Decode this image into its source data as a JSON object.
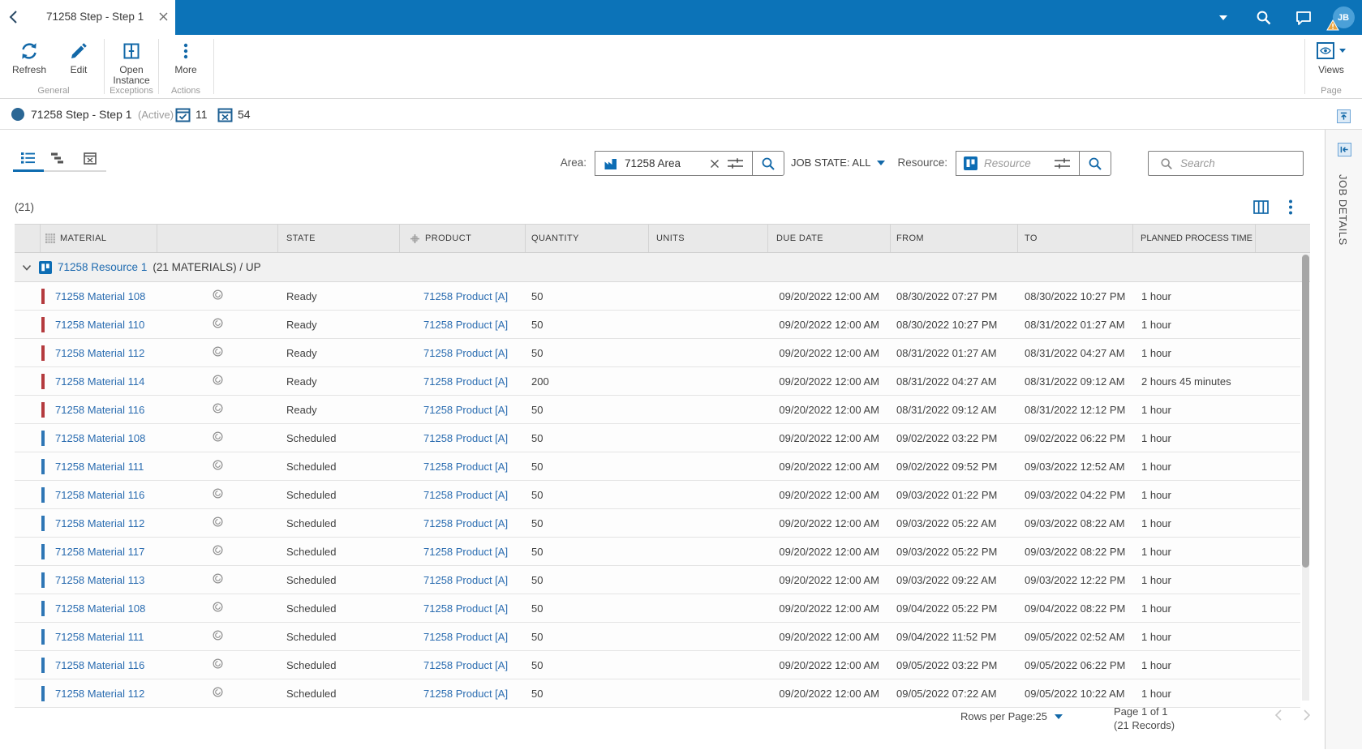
{
  "topbar": {
    "tab_title": "71258 Step - Step 1",
    "avatar_initials": "JB"
  },
  "ribbon": {
    "refresh_label": "Refresh",
    "edit_label": "Edit",
    "open_instance_label1": "Open",
    "open_instance_label2": "Instance",
    "more_label": "More",
    "views_label": "Views",
    "group_general": "General",
    "group_exceptions": "Exceptions",
    "group_actions": "Actions",
    "group_page": "Page"
  },
  "titlebar": {
    "title": "71258 Step - Step 1",
    "status": "(Active)",
    "done_count": "11",
    "error_count": "54"
  },
  "filters": {
    "area_label": "Area:",
    "area_value": "71258 Area",
    "job_state": "JOB STATE: ALL",
    "resource_label": "Resource:",
    "resource_placeholder": "Resource",
    "search_placeholder": "Search"
  },
  "grid": {
    "count": "(21)",
    "columns": {
      "material": "MATERIAL",
      "state": "STATE",
      "product": "PRODUCT",
      "quantity": "QUANTITY",
      "units": "UNITS",
      "due": "DUE DATE",
      "from": "FROM",
      "to": "TO",
      "ppt": "PLANNED PROCESS TIME"
    },
    "group_name": "71258 Resource 1",
    "group_suffix": "(21 MATERIALS) /  UP",
    "rows": [
      {
        "material": "71258 Material 108",
        "state": "Ready",
        "product": "71258 Product [A]",
        "quantity": "50",
        "due": "09/20/2022 12:00 AM",
        "from": "08/30/2022 07:27 PM",
        "to": "08/30/2022 10:27 PM",
        "ppt": "1 hour",
        "bar": "red"
      },
      {
        "material": "71258 Material 110",
        "state": "Ready",
        "product": "71258 Product [A]",
        "quantity": "50",
        "due": "09/20/2022 12:00 AM",
        "from": "08/30/2022 10:27 PM",
        "to": "08/31/2022 01:27 AM",
        "ppt": "1 hour",
        "bar": "red"
      },
      {
        "material": "71258 Material 112",
        "state": "Ready",
        "product": "71258 Product [A]",
        "quantity": "50",
        "due": "09/20/2022 12:00 AM",
        "from": "08/31/2022 01:27 AM",
        "to": "08/31/2022 04:27 AM",
        "ppt": "1 hour",
        "bar": "red"
      },
      {
        "material": "71258 Material 114",
        "state": "Ready",
        "product": "71258 Product [A]",
        "quantity": "200",
        "due": "09/20/2022 12:00 AM",
        "from": "08/31/2022 04:27 AM",
        "to": "08/31/2022 09:12 AM",
        "ppt": "2 hours 45 minutes",
        "bar": "red"
      },
      {
        "material": "71258 Material 116",
        "state": "Ready",
        "product": "71258 Product [A]",
        "quantity": "50",
        "due": "09/20/2022 12:00 AM",
        "from": "08/31/2022 09:12 AM",
        "to": "08/31/2022 12:12 PM",
        "ppt": "1 hour",
        "bar": "red"
      },
      {
        "material": "71258 Material 108",
        "state": "Scheduled",
        "product": "71258 Product [A]",
        "quantity": "50",
        "due": "09/20/2022 12:00 AM",
        "from": "09/02/2022 03:22 PM",
        "to": "09/02/2022 06:22 PM",
        "ppt": "1 hour",
        "bar": "blue"
      },
      {
        "material": "71258 Material 111",
        "state": "Scheduled",
        "product": "71258 Product [A]",
        "quantity": "50",
        "due": "09/20/2022 12:00 AM",
        "from": "09/02/2022 09:52 PM",
        "to": "09/03/2022 12:52 AM",
        "ppt": "1 hour",
        "bar": "blue"
      },
      {
        "material": "71258 Material 116",
        "state": "Scheduled",
        "product": "71258 Product [A]",
        "quantity": "50",
        "due": "09/20/2022 12:00 AM",
        "from": "09/03/2022 01:22 PM",
        "to": "09/03/2022 04:22 PM",
        "ppt": "1 hour",
        "bar": "blue"
      },
      {
        "material": "71258 Material 112",
        "state": "Scheduled",
        "product": "71258 Product [A]",
        "quantity": "50",
        "due": "09/20/2022 12:00 AM",
        "from": "09/03/2022 05:22 AM",
        "to": "09/03/2022 08:22 AM",
        "ppt": "1 hour",
        "bar": "blue"
      },
      {
        "material": "71258 Material 117",
        "state": "Scheduled",
        "product": "71258 Product [A]",
        "quantity": "50",
        "due": "09/20/2022 12:00 AM",
        "from": "09/03/2022 05:22 PM",
        "to": "09/03/2022 08:22 PM",
        "ppt": "1 hour",
        "bar": "blue"
      },
      {
        "material": "71258 Material 113",
        "state": "Scheduled",
        "product": "71258 Product [A]",
        "quantity": "50",
        "due": "09/20/2022 12:00 AM",
        "from": "09/03/2022 09:22 AM",
        "to": "09/03/2022 12:22 PM",
        "ppt": "1 hour",
        "bar": "blue"
      },
      {
        "material": "71258 Material 108",
        "state": "Scheduled",
        "product": "71258 Product [A]",
        "quantity": "50",
        "due": "09/20/2022 12:00 AM",
        "from": "09/04/2022 05:22 PM",
        "to": "09/04/2022 08:22 PM",
        "ppt": "1 hour",
        "bar": "blue"
      },
      {
        "material": "71258 Material 111",
        "state": "Scheduled",
        "product": "71258 Product [A]",
        "quantity": "50",
        "due": "09/20/2022 12:00 AM",
        "from": "09/04/2022 11:52 PM",
        "to": "09/05/2022 02:52 AM",
        "ppt": "1 hour",
        "bar": "blue"
      },
      {
        "material": "71258 Material 116",
        "state": "Scheduled",
        "product": "71258 Product [A]",
        "quantity": "50",
        "due": "09/20/2022 12:00 AM",
        "from": "09/05/2022 03:22 PM",
        "to": "09/05/2022 06:22 PM",
        "ppt": "1 hour",
        "bar": "blue"
      },
      {
        "material": "71258 Material 112",
        "state": "Scheduled",
        "product": "71258 Product [A]",
        "quantity": "50",
        "due": "09/20/2022 12:00 AM",
        "from": "09/05/2022 07:22 AM",
        "to": "09/05/2022 10:22 AM",
        "ppt": "1 hour",
        "bar": "blue"
      }
    ]
  },
  "footer": {
    "rows_per_page": "Rows per Page:25",
    "page_info": "Page 1 of 1",
    "records": "(21 Records)"
  },
  "sidebar": {
    "title": "JOB DETAILS"
  },
  "colors": {
    "red_bar": "#b43a3e",
    "blue_bar": "#2e76b5"
  }
}
